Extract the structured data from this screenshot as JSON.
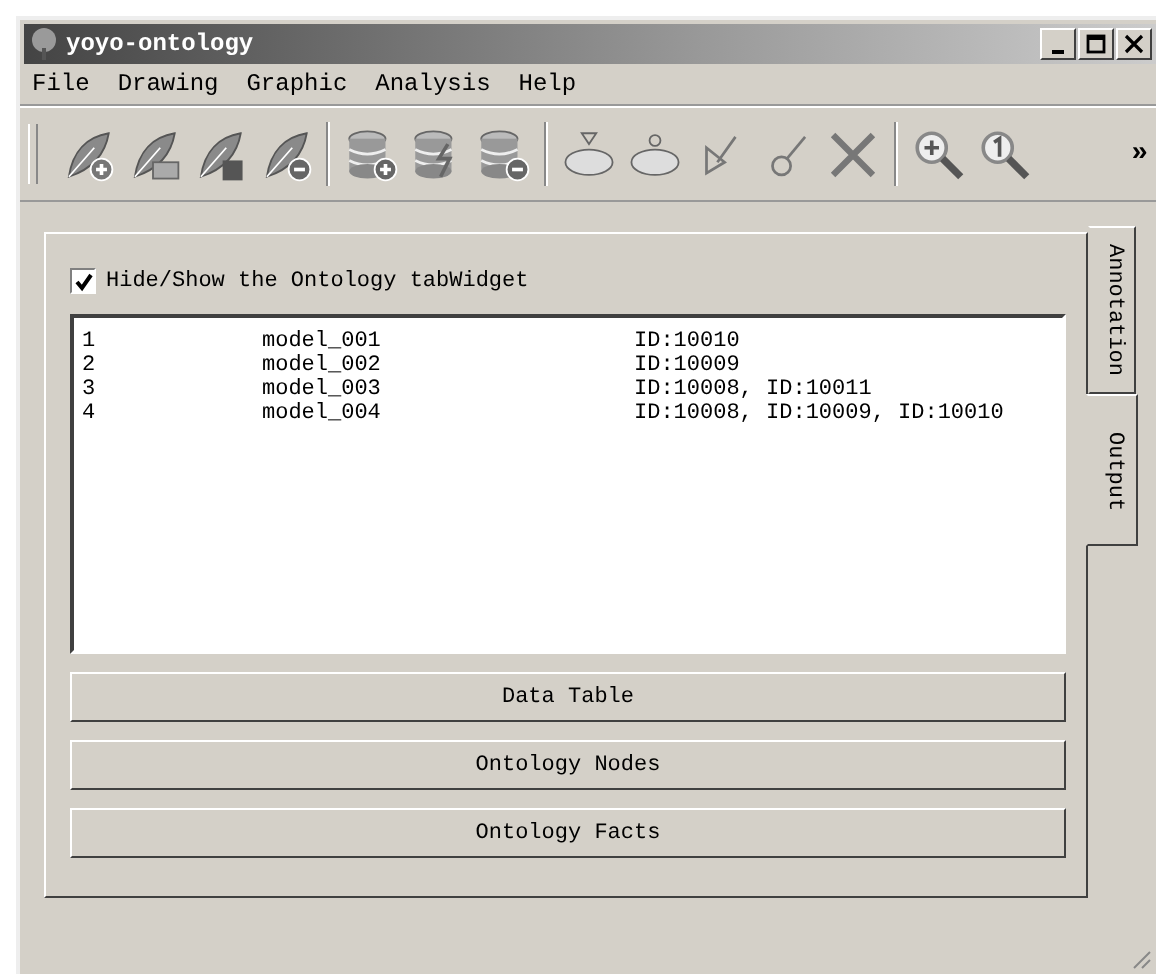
{
  "window": {
    "title": "yoyo-ontology"
  },
  "menu": [
    "File",
    "Drawing",
    "Graphic",
    "Analysis",
    "Help"
  ],
  "toolbar": {
    "overflow": "»"
  },
  "panel": {
    "checkbox": {
      "label": "Hide/Show the Ontology tabWidget",
      "checked": true
    },
    "list": [
      {
        "index": "1",
        "model": "model_001",
        "ids": "ID:10010"
      },
      {
        "index": "2",
        "model": "model_002",
        "ids": "ID:10009"
      },
      {
        "index": "3",
        "model": "model_003",
        "ids": "ID:10008,  ID:10011"
      },
      {
        "index": "4",
        "model": "model_004",
        "ids": "ID:10008,  ID:10009,  ID:10010"
      }
    ],
    "buttons": [
      "Data Table",
      "Ontology Nodes",
      "Ontology Facts"
    ]
  },
  "side_tabs": [
    {
      "label": "Annotation",
      "selected": false
    },
    {
      "label": "Output",
      "selected": true
    }
  ]
}
